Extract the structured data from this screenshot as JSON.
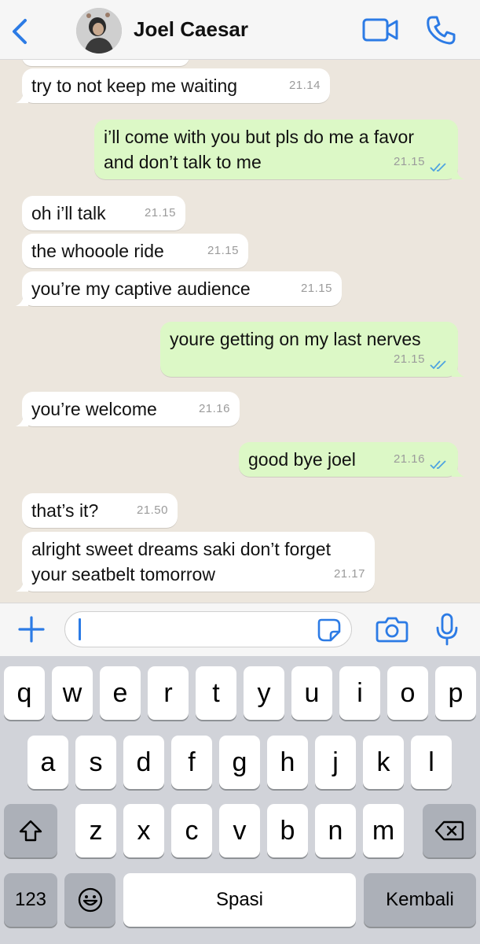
{
  "header": {
    "contact_name": "Joel Caesar",
    "back_icon": "chevron-left-icon",
    "video_icon": "video-call-icon",
    "call_icon": "phone-icon"
  },
  "colors": {
    "accent": "#2c7be5",
    "incoming_bubble": "#ffffff",
    "outgoing_bubble": "#dcf8c6",
    "chat_background": "#ece6dd",
    "read_ticks": "#4fa3e0"
  },
  "messages": [
    {
      "direction": "in",
      "text": "try to not keep me waiting",
      "time": "21.14"
    },
    {
      "direction": "out",
      "text": "i’ll come with you but pls do me a favor\nand don’t talk to me",
      "time": "21.15",
      "status": "read"
    },
    {
      "direction": "in",
      "text": "oh i’ll talk",
      "time": "21.15"
    },
    {
      "direction": "in",
      "text": "the whooole ride",
      "time": "21.15"
    },
    {
      "direction": "in",
      "text": "you’re my captive audience",
      "time": "21.15"
    },
    {
      "direction": "out",
      "text": "youre getting on my last nerves",
      "time": "21.15",
      "status": "read"
    },
    {
      "direction": "in",
      "text": "you’re welcome",
      "time": "21.16"
    },
    {
      "direction": "out",
      "text": "good bye joel",
      "time": "21.16",
      "status": "read"
    },
    {
      "direction": "in",
      "text": "that’s it?",
      "time": "21.50"
    },
    {
      "direction": "in",
      "text": "alright sweet dreams saki don’t forget\nyour seatbelt tomorrow",
      "time": "21.17"
    }
  ],
  "input_bar": {
    "plus_icon": "plus-icon",
    "message_value": "",
    "sticker_icon": "sticker-icon",
    "camera_icon": "camera-icon",
    "mic_icon": "microphone-icon"
  },
  "keyboard": {
    "row1": [
      "q",
      "w",
      "e",
      "r",
      "t",
      "y",
      "u",
      "i",
      "o",
      "p"
    ],
    "row2": [
      "a",
      "s",
      "d",
      "f",
      "g",
      "h",
      "j",
      "k",
      "l"
    ],
    "row3": [
      "z",
      "x",
      "c",
      "v",
      "b",
      "n",
      "m"
    ],
    "shift_icon": "shift-icon",
    "delete_icon": "backspace-icon",
    "numbers_label": "123",
    "emoji_icon": "emoji-icon",
    "space_label": "Spasi",
    "return_label": "Kembali"
  }
}
